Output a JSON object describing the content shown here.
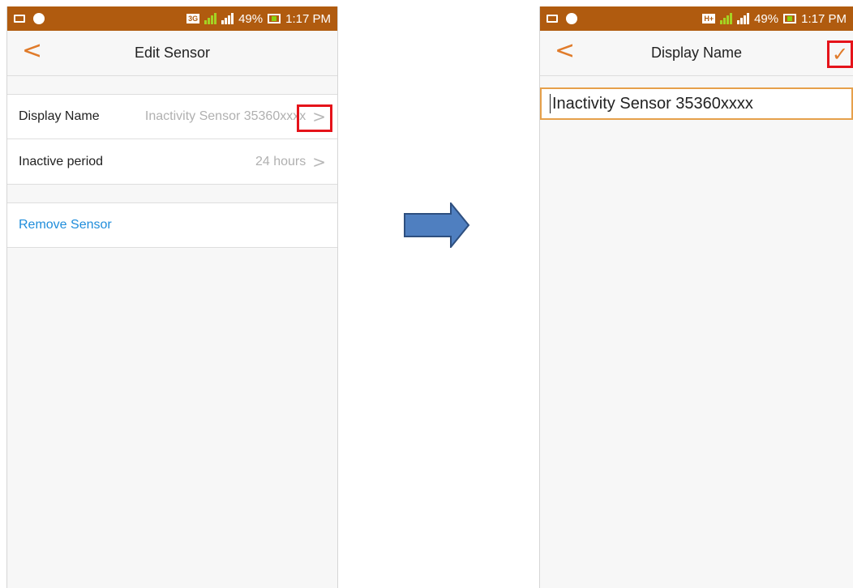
{
  "status_bar": {
    "network_left": "3G",
    "network_right": "H+",
    "sim1": "1",
    "sim2": "2",
    "battery": "49%",
    "time": "1:17 PM"
  },
  "left_screen": {
    "title": "Edit Sensor",
    "back_label": "<",
    "rows": [
      {
        "label": "Display Name",
        "value": "Inactivity Sensor 35360xxxx",
        "chevron": ">"
      },
      {
        "label": "Inactive period",
        "value": "24 hours",
        "chevron": ">"
      }
    ],
    "remove_label": "Remove Sensor"
  },
  "right_screen": {
    "title": "Display Name",
    "back_label": "<",
    "confirm_label": "✓",
    "input_value": "Inactivity Sensor 35360xxxx"
  },
  "colors": {
    "status_bar": "#b05b0f",
    "accent": "#e07b2a",
    "link": "#1f8ddb",
    "highlight": "#e5131a",
    "arrow_fill": "#4f7fc0"
  }
}
